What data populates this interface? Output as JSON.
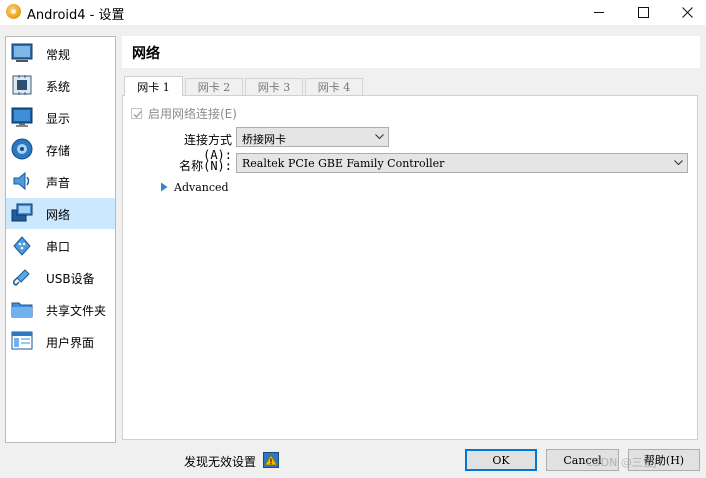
{
  "window": {
    "title": "Android4 - 设置"
  },
  "sidebar": {
    "items": [
      {
        "label": "常规",
        "icon": "general-icon"
      },
      {
        "label": "系统",
        "icon": "system-icon"
      },
      {
        "label": "显示",
        "icon": "display-icon"
      },
      {
        "label": "存储",
        "icon": "storage-icon"
      },
      {
        "label": "声音",
        "icon": "audio-icon"
      },
      {
        "label": "网络",
        "icon": "network-icon",
        "selected": true
      },
      {
        "label": "串口",
        "icon": "serial-port-icon"
      },
      {
        "label": "USB设备",
        "icon": "usb-icon"
      },
      {
        "label": "共享文件夹",
        "icon": "shared-folder-icon"
      },
      {
        "label": "用户界面",
        "icon": "user-interface-icon"
      }
    ]
  },
  "main": {
    "header_title": "网络",
    "tabs": [
      {
        "label": "网卡 1",
        "active": true
      },
      {
        "label": "网卡 2"
      },
      {
        "label": "网卡 3"
      },
      {
        "label": "网卡 4"
      }
    ],
    "enable_adapter": {
      "label": "启用网络连接(E)",
      "checked": true,
      "disabled": true
    },
    "attached_to": {
      "label": "连接方式(A):",
      "value": "桥接网卡"
    },
    "name": {
      "label": "名称(N):",
      "value": "Realtek PCIe GBE Family Controller"
    },
    "advanced_label": "Advanced"
  },
  "footer": {
    "invalid_settings_text": "发现无效设置",
    "ok_label": "OK",
    "cancel_label": "Cancel",
    "help_label": "帮助(H)",
    "watermark": "CSDN @三金JT"
  },
  "colors": {
    "selection": "#cce8ff",
    "accent": "#0078d7",
    "icon_blue": "#1e6fb8"
  }
}
